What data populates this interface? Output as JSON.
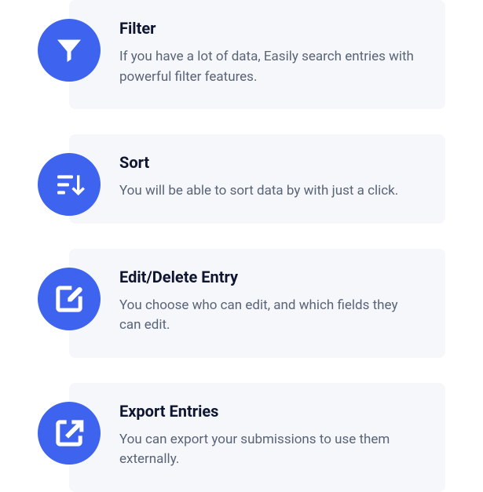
{
  "features": [
    {
      "icon": "filter-icon",
      "title": "Filter",
      "desc": "If you have a lot of data, Easily search entries with powerful filter features."
    },
    {
      "icon": "sort-icon",
      "title": "Sort",
      "desc": "You will be able to sort data by with just a click."
    },
    {
      "icon": "edit-icon",
      "title": "Edit/Delete Entry",
      "desc": "You choose who can edit, and which fields they can edit."
    },
    {
      "icon": "export-icon",
      "title": "Export Entries",
      "desc": "You can export your submissions to use them externally."
    }
  ]
}
